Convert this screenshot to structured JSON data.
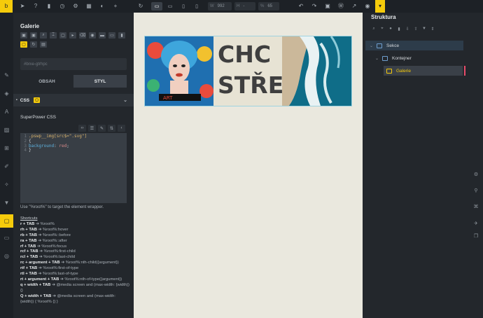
{
  "topbar": {
    "logo": "bricks-logo",
    "left_icons": [
      "cursor-icon",
      "help-icon",
      "page-icon",
      "history-icon",
      "gear-icon",
      "grid-icon",
      "contrast-icon",
      "plus-icon"
    ],
    "devices": [
      "refresh-icon",
      "desktop-icon",
      "laptop-icon",
      "tablet-icon",
      "mobile-icon"
    ],
    "width_label": "W",
    "width_value": "992",
    "height_label": "H",
    "height_value": "-",
    "zoom_label": "%",
    "zoom_value": "65",
    "right_icons": [
      "undo-icon",
      "redo-icon",
      "save-icon",
      "wordpress-icon",
      "share-icon",
      "view-icon"
    ]
  },
  "left": {
    "title": "Galerie",
    "element_id": "#brxe-gtrhpc",
    "tab_content": "OBSAH",
    "tab_style": "STYL",
    "css_section": "CSS",
    "superpower_label": "SuperPower CSS",
    "code": [
      {
        "n": "1",
        "text": ".pswp__img[src$=\".svg\"]",
        "type": "sel"
      },
      {
        "n": "2",
        "text": "{",
        "type": "plain"
      },
      {
        "n": "3",
        "prop": "background",
        "val": "red",
        "type": "decl"
      },
      {
        "n": "4",
        "text": "}",
        "type": "plain"
      }
    ],
    "hint": "Use \"%root%\" to target the element wrapper.",
    "shortcuts_title": "Shortcuts",
    "shortcuts": [
      {
        "key": "r + TAB",
        "val": "%root%"
      },
      {
        "key": "rh + TAB",
        "val": "%root%:hover"
      },
      {
        "key": "rb + TAB",
        "val": "%root%::before"
      },
      {
        "key": "ra + TAB",
        "val": "%root%::after"
      },
      {
        "key": "rf + TAB",
        "val": "%root%:focus"
      },
      {
        "key": "rcf + TAB",
        "val": "%root%:first-child"
      },
      {
        "key": "rcl + TAB",
        "val": "%root%:last-child"
      },
      {
        "key": "rc + argument + TAB",
        "val": "%root%:nth-child({argument})"
      },
      {
        "key": "rtf + TAB",
        "val": "%root%:first-of-type"
      },
      {
        "key": "rtl + TAB",
        "val": "%root%:last-of-type"
      },
      {
        "key": "rt + argument + TAB",
        "val": "%root%:nth-of-type({argument})"
      },
      {
        "key": "q + width + TAB",
        "val": "@media screen and (max-width: {width}) {}"
      },
      {
        "key": "Q + width + TAB",
        "val": "@media screen and (max-width: {width}) { %root% {} }"
      }
    ]
  },
  "canvas": {
    "headline_line1": "CHC",
    "headline_line2": "STŘE"
  },
  "right": {
    "title": "Struktura",
    "nodes": [
      {
        "label": "Sekce"
      },
      {
        "label": "Kontejner"
      },
      {
        "label": "Galerie"
      }
    ]
  },
  "colors": {
    "accent": "#f5cb0b",
    "canvas_bg": "#eae8de",
    "selected_node": "#f5cb0b"
  }
}
